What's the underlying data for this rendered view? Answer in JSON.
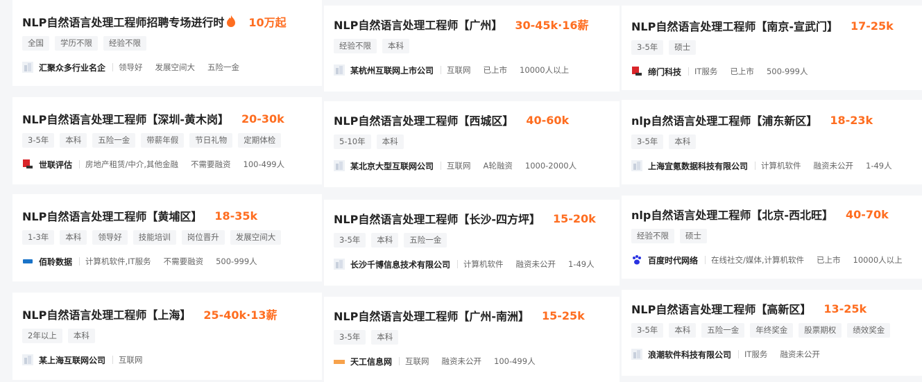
{
  "jobs": [
    {
      "title": "NLP自然语言处理工程师招聘专场进行时",
      "hot": true,
      "salary": "10万起",
      "tags": [
        "全国",
        "学历不限",
        "经验不限"
      ],
      "company": "汇聚众多行业名企",
      "meta": [
        "领导好",
        "发展空间大",
        "五险一金"
      ],
      "logo": "generic-logo-icon"
    },
    {
      "title": "NLP自然语言处理工程师【广州】",
      "salary": "30-45k·16薪",
      "tags": [
        "经验不限",
        "本科"
      ],
      "company": "某杭州互联网上市公司",
      "meta": [
        "互联网",
        "已上市",
        "10000人以上"
      ],
      "logo": "generic-logo-icon"
    },
    {
      "title": "NLP自然语言处理工程师【南京-宣武门】",
      "salary": "17-25k",
      "tags": [
        "3-5年",
        "硕士"
      ],
      "company": "缔门科技",
      "meta": [
        "IT服务",
        "已上市",
        "500-999人"
      ],
      "logo": "red-logo-icon"
    },
    {
      "title": "NLP自然语言处理工程师【深圳-黄木岗】",
      "salary": "20-30k",
      "tags": [
        "3-5年",
        "本科",
        "五险一金",
        "带薪年假",
        "节日礼物",
        "定期体检"
      ],
      "company": "世联评估",
      "meta": [
        "房地产租赁/中介,其他金融",
        "不需要融资",
        "100-499人"
      ],
      "logo": "red-logo-icon"
    },
    {
      "title": "NLP自然语言处理工程师【西城区】",
      "salary": "40-60k",
      "tags": [
        "5-10年",
        "本科"
      ],
      "company": "某北京大型互联网公司",
      "meta": [
        "互联网",
        "A轮融资",
        "1000-2000人"
      ],
      "logo": "generic-logo-icon"
    },
    {
      "title": "nlp自然语言处理工程师【浦东新区】",
      "salary": "18-23k",
      "tags": [
        "3-5年",
        "本科"
      ],
      "company": "上海宜氪数据科技有限公司",
      "meta": [
        "计算机软件",
        "融资未公开",
        "1-49人"
      ],
      "logo": "generic-logo-icon"
    },
    {
      "title": "NLP自然语言处理工程师【黄埔区】",
      "salary": "18-35k",
      "tags": [
        "1-3年",
        "本科",
        "领导好",
        "技能培训",
        "岗位晋升",
        "发展空间大"
      ],
      "company": "佰聆数据",
      "meta": [
        "计算机软件,IT服务",
        "不需要融资",
        "500-999人"
      ],
      "logo": "blue-logo-icon"
    },
    {
      "title": "NLP自然语言处理工程师【长沙-四方坪】",
      "salary": "15-20k",
      "tags": [
        "3-5年",
        "本科",
        "五险一金"
      ],
      "company": "长沙千博信息技术有限公司",
      "meta": [
        "计算机软件",
        "融资未公开",
        "1-49人"
      ],
      "logo": "generic-logo-icon"
    },
    {
      "title": "nlp自然语言处理工程师【北京-西北旺】",
      "salary": "40-70k",
      "tags": [
        "经验不限",
        "硕士"
      ],
      "company": "百度时代网络",
      "meta": [
        "在线社交/媒体,计算机软件",
        "已上市",
        "10000人以上"
      ],
      "logo": "paw-logo-icon"
    },
    {
      "title": "NLP自然语言处理工程师【上海】",
      "salary": "25-40k·13薪",
      "tags": [
        "2年以上",
        "本科"
      ],
      "company": "某上海互联网公司",
      "meta": [
        "互联网"
      ],
      "logo": "generic-logo-icon"
    },
    {
      "title": "NLP自然语言处理工程师【广州-南洲】",
      "salary": "15-25k",
      "tags": [
        "3-5年",
        "本科"
      ],
      "company": "天工信息网",
      "meta": [
        "互联网",
        "融资未公开",
        "100-499人"
      ],
      "logo": "orange-logo-icon"
    },
    {
      "title": "NLP自然语言处理工程师【高新区】",
      "salary": "13-25k",
      "tags": [
        "3-5年",
        "本科",
        "五险一金",
        "年终奖金",
        "股票期权",
        "绩效奖金"
      ],
      "company": "浪潮软件科技有限公司",
      "meta": [
        "IT服务",
        "融资未公开"
      ],
      "logo": "generic-logo-icon"
    }
  ],
  "colors": {
    "salary": "#fe6d20",
    "tag_bg": "#f4f5f7",
    "page_bg": "#f5f6f8"
  }
}
